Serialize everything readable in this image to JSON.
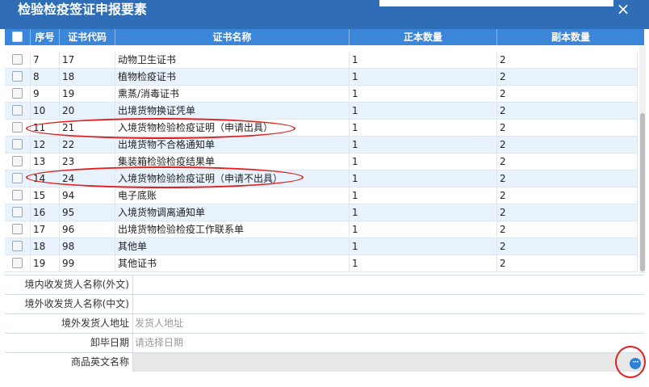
{
  "dialog": {
    "title": "检验检疫签证申报要素",
    "close_glyph": "×"
  },
  "table": {
    "headers": {
      "index": "序号",
      "code": "证书代码",
      "name": "证书名称",
      "original_qty": "正本数量",
      "copy_qty": "副本数量"
    },
    "rows": [
      {
        "index": "7",
        "code": "17",
        "name": "动物卫生证书",
        "original_qty": "1",
        "copy_qty": "2"
      },
      {
        "index": "8",
        "code": "18",
        "name": "植物检疫证书",
        "original_qty": "1",
        "copy_qty": "2"
      },
      {
        "index": "9",
        "code": "19",
        "name": "熏蒸/消毒证书",
        "original_qty": "1",
        "copy_qty": "2"
      },
      {
        "index": "10",
        "code": "20",
        "name": "出境货物换证凭单",
        "original_qty": "1",
        "copy_qty": "2"
      },
      {
        "index": "11",
        "code": "21",
        "name": "入境货物检验检疫证明（申请出具）",
        "original_qty": "1",
        "copy_qty": "2"
      },
      {
        "index": "12",
        "code": "22",
        "name": "出境货物不合格通知单",
        "original_qty": "1",
        "copy_qty": "2"
      },
      {
        "index": "13",
        "code": "23",
        "name": "集装箱检验检疫结果单",
        "original_qty": "1",
        "copy_qty": "2"
      },
      {
        "index": "14",
        "code": "24",
        "name": "入境货物检验检疫证明（申请不出具）",
        "original_qty": "1",
        "copy_qty": "2"
      },
      {
        "index": "15",
        "code": "94",
        "name": "电子底账",
        "original_qty": "1",
        "copy_qty": "2"
      },
      {
        "index": "16",
        "code": "95",
        "name": "入境货物调离通知单",
        "original_qty": "1",
        "copy_qty": "2"
      },
      {
        "index": "17",
        "code": "96",
        "name": "出境货物检验检疫工作联系单",
        "original_qty": "1",
        "copy_qty": "2"
      },
      {
        "index": "18",
        "code": "98",
        "name": "其他单",
        "original_qty": "1",
        "copy_qty": "2"
      },
      {
        "index": "19",
        "code": "99",
        "name": "其他证书",
        "original_qty": "1",
        "copy_qty": "2"
      }
    ]
  },
  "form": {
    "domestic_consignee_foreign": {
      "label": "境内收发货人名称(外文)",
      "value": "",
      "placeholder": ""
    },
    "overseas_consignee_chinese": {
      "label": "境外收发货人名称(中文)",
      "value": "",
      "placeholder": ""
    },
    "overseas_shipper_address": {
      "label": "境外发货人地址",
      "value": "",
      "placeholder": "发货人地址"
    },
    "unloading_date": {
      "label": "卸毕日期",
      "value": "",
      "placeholder": "请选择日期"
    },
    "goods_english_name": {
      "label": "商品英文名称",
      "value": "",
      "placeholder": ""
    }
  },
  "colors": {
    "title_bar": "#2f6db6",
    "header": "#3c86d9",
    "alt_row": "#e8f3fe",
    "annotation": "#e02020"
  },
  "icons": {
    "close": "close-icon",
    "more": "more-dots-icon"
  }
}
